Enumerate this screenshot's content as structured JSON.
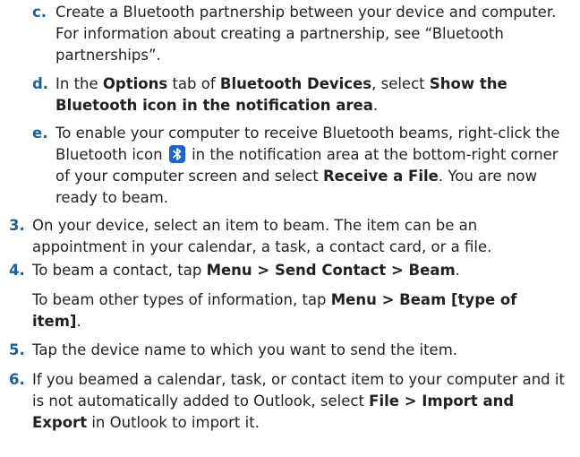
{
  "steps": {
    "c": {
      "marker": "c.",
      "text": "Create a Bluetooth partnership between your device and computer. For information about creating a partnership, see “Bluetooth partnerships”."
    },
    "d": {
      "marker": "d.",
      "t1": "In the ",
      "b1": "Options",
      "t2": " tab of ",
      "b2": "Bluetooth Devices",
      "t3": ", select ",
      "b3": "Show the Bluetooth icon in the notification area",
      "t4": "."
    },
    "e": {
      "marker": "e.",
      "t1": "To enable your computer to receive Bluetooth beams, right-click the Bluetooth icon",
      "t2": "in the notification area at the bottom-right corner of your computer screen and select ",
      "b1": "Receive a File",
      "t3": ". You are now ready to beam."
    },
    "s3": {
      "marker": "3.",
      "text": "On your device, select an item to beam. The item can be an appointment in your calendar, a task, a contact card, or a file."
    },
    "s4": {
      "marker": "4.",
      "t1": "To beam a contact, tap ",
      "b1": "Menu > Send Contact > Beam",
      "t2": "."
    },
    "s4b": {
      "t1": "To beam other types of information, tap ",
      "b1": "Menu > Beam [type of item]",
      "t2": "."
    },
    "s5": {
      "marker": "5.",
      "text": "Tap the device name to which you want to send the item."
    },
    "s6": {
      "marker": "6.",
      "t1": "If you beamed a calendar, task, or contact item to your computer and it is not automatically added to Outlook, select ",
      "b1": "File > Import and Export",
      "t2": " in Outlook to import it."
    }
  },
  "colors": {
    "marker": "#1c5e9c",
    "text": "#231f20",
    "bluetooth_icon": "#1e63c8"
  },
  "icons": {
    "inline": "bluetooth-icon"
  }
}
